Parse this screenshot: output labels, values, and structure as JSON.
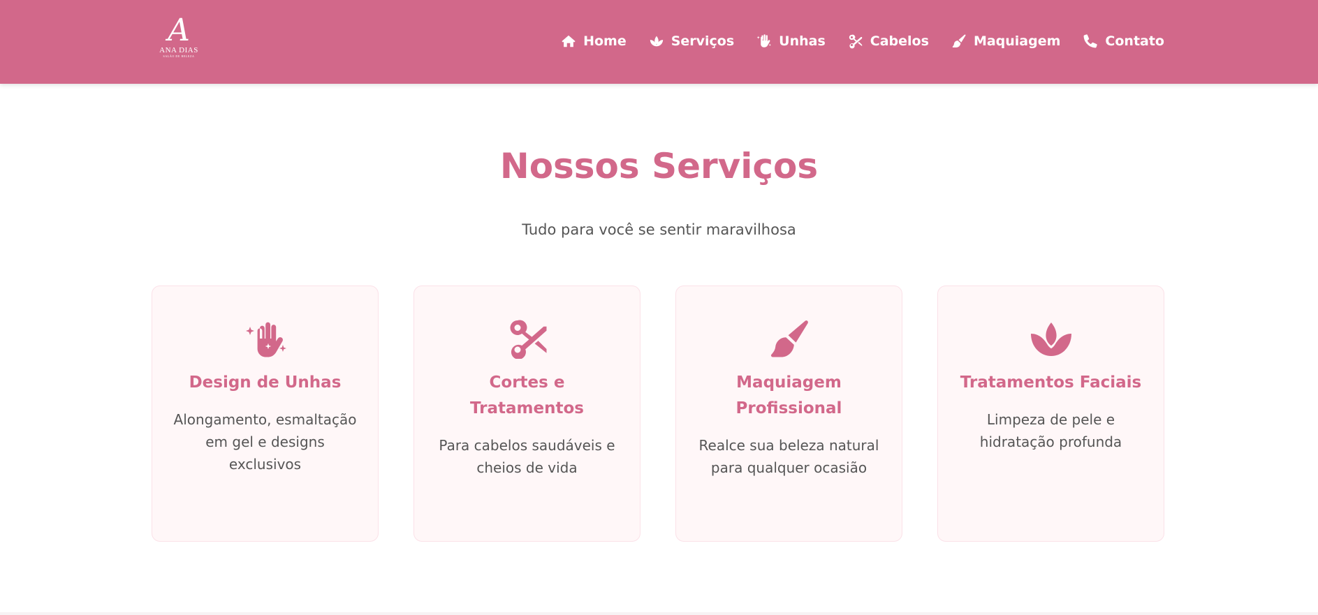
{
  "brand": {
    "logo_mark": "A",
    "logo_name": "ANA DIAS",
    "logo_sub": "SALÃO DE BELEZA"
  },
  "nav": {
    "items": [
      {
        "label": "Home",
        "icon": "home-icon"
      },
      {
        "label": "Serviços",
        "icon": "lotus-icon"
      },
      {
        "label": "Unhas",
        "icon": "hand-sparkles-icon"
      },
      {
        "label": "Cabelos",
        "icon": "scissors-icon"
      },
      {
        "label": "Maquiagem",
        "icon": "paintbrush-icon"
      },
      {
        "label": "Contato",
        "icon": "phone-icon"
      }
    ]
  },
  "services": {
    "title": "Nossos Serviços",
    "subtitle": "Tudo para você se sentir maravilhosa",
    "cards": [
      {
        "icon": "hand-sparkles-icon",
        "title": "Design de Unhas",
        "text": "Alongamento, esmaltação em gel e designs exclusivos"
      },
      {
        "icon": "scissors-icon",
        "title": "Cortes e Tratamentos",
        "text": "Para cabelos saudáveis e cheios de vida"
      },
      {
        "icon": "paintbrush-icon",
        "title": "Maquiagem Profissional",
        "text": "Realce sua beleza natural para qualquer ocasião"
      },
      {
        "icon": "lotus-icon",
        "title": "Tratamentos Faciais",
        "text": "Limpeza de pele e hidratação profunda"
      }
    ]
  },
  "colors": {
    "brand_pink": "#d2688a",
    "card_background": "#fff7f8",
    "body_text": "#555555"
  }
}
